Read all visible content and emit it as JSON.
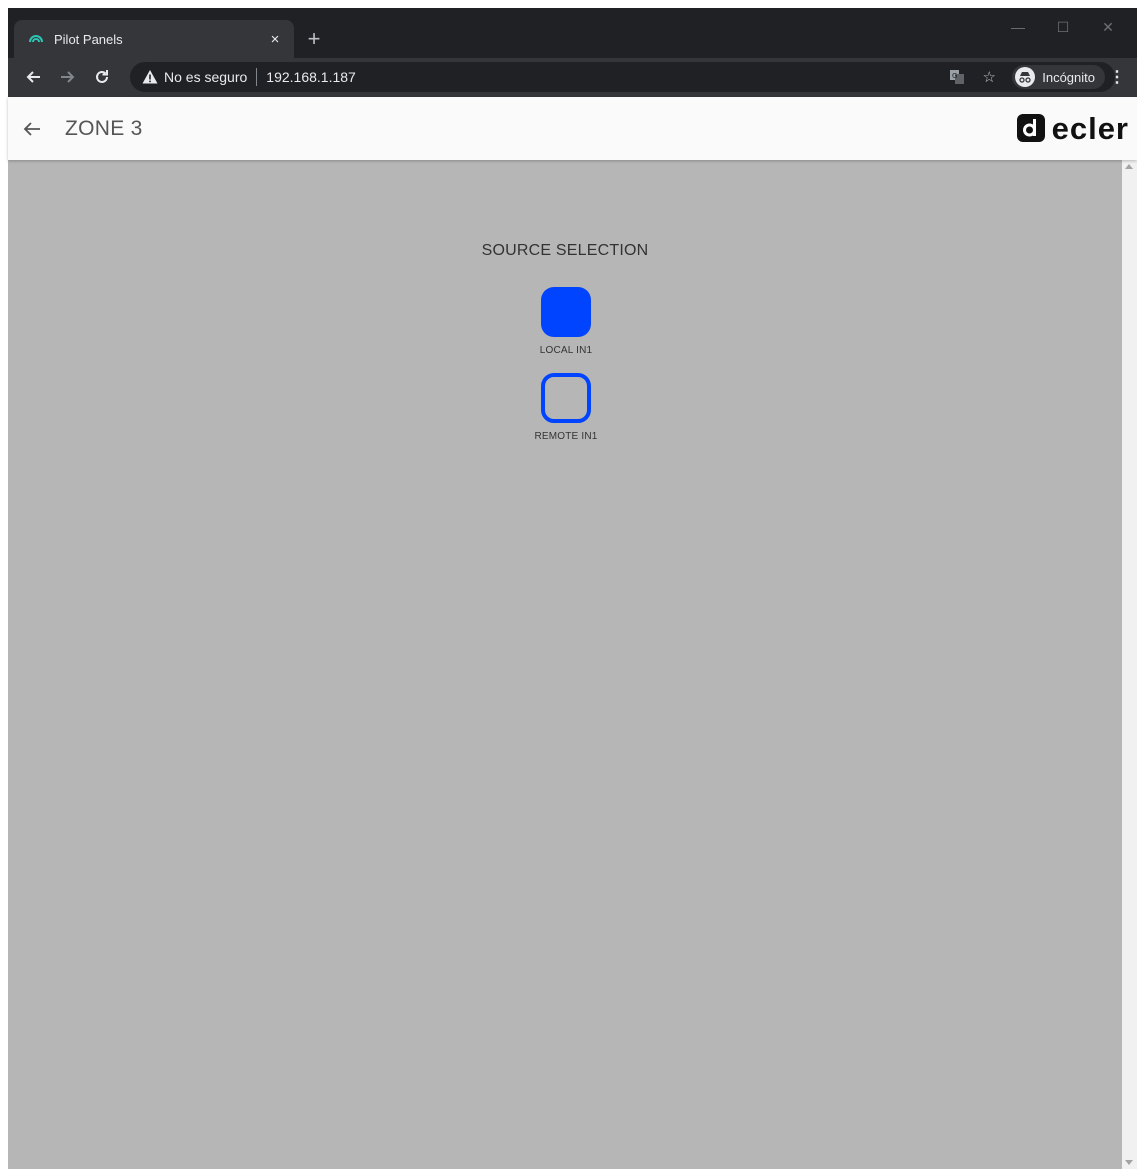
{
  "browser": {
    "tab_title": "Pilot Panels",
    "tab_close": "×",
    "new_tab": "+",
    "security_text": "No es seguro",
    "url": "192.168.1.187",
    "incognito_label": "Incógnito",
    "colors": {
      "chrome_dark": "#202124",
      "toolbar": "#35363a",
      "favicon": "#2ec4b6"
    }
  },
  "app": {
    "title": "ZONE 3",
    "logo_text": "ecler"
  },
  "source_selection": {
    "title": "SOURCE SELECTION",
    "sources": [
      {
        "label": "LOCAL IN1",
        "selected": true
      },
      {
        "label": "REMOTE IN1",
        "selected": false
      }
    ],
    "accent_color": "#0044ff"
  },
  "page": {
    "background": "#b6b6b6"
  }
}
